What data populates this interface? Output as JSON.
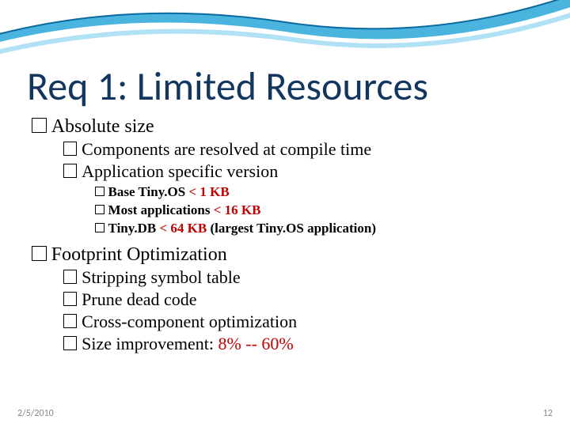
{
  "title": "Req 1: Limited Resources",
  "b1": {
    "t": "Absolute size",
    "c": [
      {
        "t": "Components are resolved at compile time"
      },
      {
        "t": "Application specific version",
        "c": [
          {
            "pre": "Base Tiny.OS ",
            "red": "< 1 KB"
          },
          {
            "pre": "Most applications ",
            "red": "< 16 KB"
          },
          {
            "pre": "Tiny.DB ",
            "red": "< 64 KB ",
            "post": "(largest Tiny.OS application)"
          }
        ]
      }
    ]
  },
  "b2": {
    "t": "Footprint Optimization",
    "c": [
      {
        "t": "Stripping symbol table"
      },
      {
        "t": "Prune dead code"
      },
      {
        "t": "Cross-component optimization"
      },
      {
        "pre": "Size improvement: ",
        "red": "8% -- 60%"
      }
    ]
  },
  "footer": {
    "date": "2/5/2010",
    "page": "12"
  }
}
